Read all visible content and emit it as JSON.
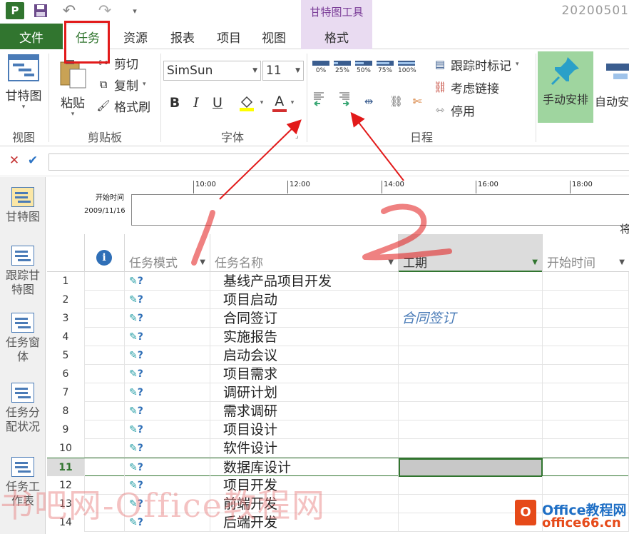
{
  "titlebar": {
    "app_icon": "P",
    "contextual_group": "甘特图工具",
    "window_title": "20200501"
  },
  "tabs": [
    {
      "label": "文件"
    },
    {
      "label": "任务"
    },
    {
      "label": "资源"
    },
    {
      "label": "报表"
    },
    {
      "label": "项目"
    },
    {
      "label": "视图"
    },
    {
      "label": "格式"
    }
  ],
  "ribbon": {
    "view_group": {
      "gantt_label": "甘特图",
      "group_label": "视图"
    },
    "clipboard_group": {
      "paste_label": "粘贴",
      "cut_label": "剪切",
      "copy_label": "复制",
      "format_painter_label": "格式刷",
      "group_label": "剪贴板"
    },
    "font_group": {
      "font_name": "SimSun",
      "font_size": "11",
      "bold": "B",
      "italic": "I",
      "underline": "U",
      "font_color_glyph": "A",
      "group_label": "字体"
    },
    "schedule_group": {
      "percent_buttons": [
        {
          "label": "0%",
          "value": 0
        },
        {
          "label": "25%",
          "value": 25
        },
        {
          "label": "50%",
          "value": 50
        },
        {
          "label": "75%",
          "value": 75
        },
        {
          "label": "100%",
          "value": 100
        }
      ],
      "track_label": "跟踪时标记",
      "respect_links_label": "考虑链接",
      "inactivate_label": "停用",
      "group_label": "日程"
    },
    "tasks_group": {
      "manual_label": "手动安排",
      "auto_label": "自动安"
    }
  },
  "timeline": {
    "start_label": "开始时间",
    "start_date": "2009/11/16",
    "ticks": [
      "10:00",
      "12:00",
      "14:00",
      "16:00",
      "18:00"
    ],
    "end_text": "将"
  },
  "viewbar": [
    {
      "label": "甘特图"
    },
    {
      "label": "跟踪甘特图"
    },
    {
      "label": "任务窗体"
    },
    {
      "label": "任务分配状况"
    },
    {
      "label": "任务工作表"
    }
  ],
  "grid": {
    "columns": {
      "mode": "任务模式",
      "name": "任务名称",
      "duration": "工期",
      "start": "开始时间"
    },
    "selected_row": 11,
    "rows": [
      {
        "id": "1",
        "name": "基线产品项目开发",
        "duration": ""
      },
      {
        "id": "2",
        "name": "项目启动",
        "duration": ""
      },
      {
        "id": "3",
        "name": "合同签订",
        "duration": "合同签订"
      },
      {
        "id": "4",
        "name": "实施报告",
        "duration": ""
      },
      {
        "id": "5",
        "name": "启动会议",
        "duration": ""
      },
      {
        "id": "6",
        "name": "项目需求",
        "duration": ""
      },
      {
        "id": "7",
        "name": "调研计划",
        "duration": ""
      },
      {
        "id": "8",
        "name": "需求调研",
        "duration": ""
      },
      {
        "id": "9",
        "name": "项目设计",
        "duration": ""
      },
      {
        "id": "10",
        "name": "软件设计",
        "duration": ""
      },
      {
        "id": "11",
        "name": "数据库设计",
        "duration": ""
      },
      {
        "id": "12",
        "name": "项目开发",
        "duration": ""
      },
      {
        "id": "13",
        "name": "前端开发",
        "duration": ""
      },
      {
        "id": "14",
        "name": "后端开发",
        "duration": ""
      }
    ]
  },
  "annotations": {
    "label_1": "1",
    "label_2": "2",
    "color": "#e21a1a"
  },
  "watermark": "书吧网-Office教程网",
  "logo": {
    "mark": "O",
    "line1": "Office教程网",
    "line2": "office66.cn"
  }
}
